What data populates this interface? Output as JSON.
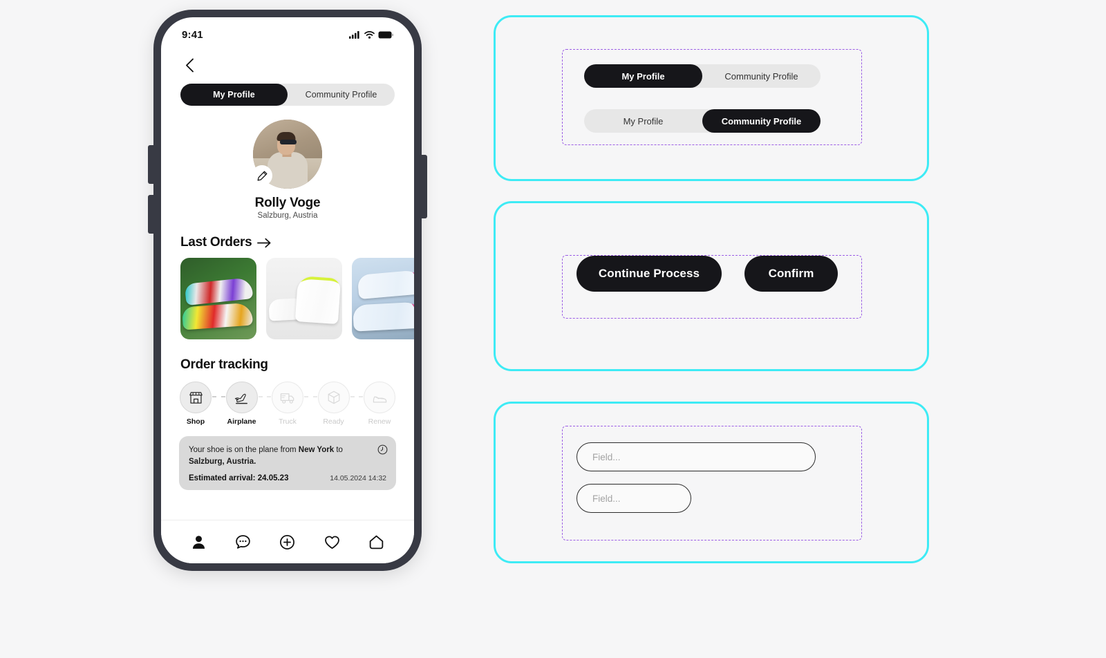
{
  "canvas": {
    "background": "#f6f6f7",
    "accent_cyan": "#3eebf5",
    "accent_purple": "#9b5de5",
    "ink": "#16161a"
  },
  "phone": {
    "status_bar": {
      "time": "9:41",
      "icons": [
        "signal-bars-icon",
        "wifi-icon",
        "battery-icon"
      ]
    },
    "back_icon": "chevron-left-icon",
    "segmented": {
      "options": [
        {
          "label": "My Profile",
          "active": true
        },
        {
          "label": "Community Profile",
          "active": false
        }
      ]
    },
    "profile": {
      "avatar_alt": "user-avatar",
      "edit_icon": "pencil-icon",
      "name": "Rolly Voge",
      "location": "Salzburg, Austria"
    },
    "last_orders": {
      "title": "Last Orders",
      "arrow": "arrow-right-icon",
      "items": [
        {
          "alt": "custom-sneaker-colorblock"
        },
        {
          "alt": "custom-sneaker-neon-drip"
        },
        {
          "alt": "custom-sneaker-cartoon-pink"
        }
      ]
    },
    "order_tracking": {
      "title": "Order tracking",
      "steps": [
        {
          "label": "Shop",
          "icon": "storefront-icon",
          "active": true
        },
        {
          "label": "Airplane",
          "icon": "airplane-icon",
          "active": true
        },
        {
          "label": "Truck",
          "icon": "delivery-truck-icon",
          "active": false
        },
        {
          "label": "Ready",
          "icon": "package-box-icon",
          "active": false
        },
        {
          "label": "Renew",
          "icon": "shoe-icon",
          "active": false
        }
      ]
    },
    "status_card": {
      "message_prefix": "Your shoe is on the plane from ",
      "origin": "New York",
      "message_mid": " to ",
      "destination": "Salzburg, Austria.",
      "eta_label": "Estimated arrival: 24.05.23",
      "timestamp": "14.05.2024 14:32",
      "clock_icon": "clock-icon"
    },
    "tabbar": {
      "items": [
        {
          "icon": "person-icon",
          "active": true
        },
        {
          "icon": "chat-bubble-icon",
          "active": false
        },
        {
          "icon": "plus-circle-icon",
          "active": false
        },
        {
          "icon": "heart-icon",
          "active": false
        },
        {
          "icon": "home-icon",
          "active": false
        }
      ]
    }
  },
  "specs": {
    "panel_toggles": {
      "rows": [
        {
          "options": [
            {
              "label": "My Profile",
              "active": true
            },
            {
              "label": "Community Profile",
              "active": false
            }
          ]
        },
        {
          "options": [
            {
              "label": "My Profile",
              "active": false
            },
            {
              "label": "Community Profile",
              "active": true
            }
          ]
        }
      ]
    },
    "panel_buttons": {
      "buttons": [
        {
          "label": "Continue Process"
        },
        {
          "label": "Confirm"
        }
      ]
    },
    "panel_fields": {
      "fields": [
        {
          "placeholder": "Field...",
          "value": ""
        },
        {
          "placeholder": "Field...",
          "value": ""
        }
      ]
    }
  }
}
